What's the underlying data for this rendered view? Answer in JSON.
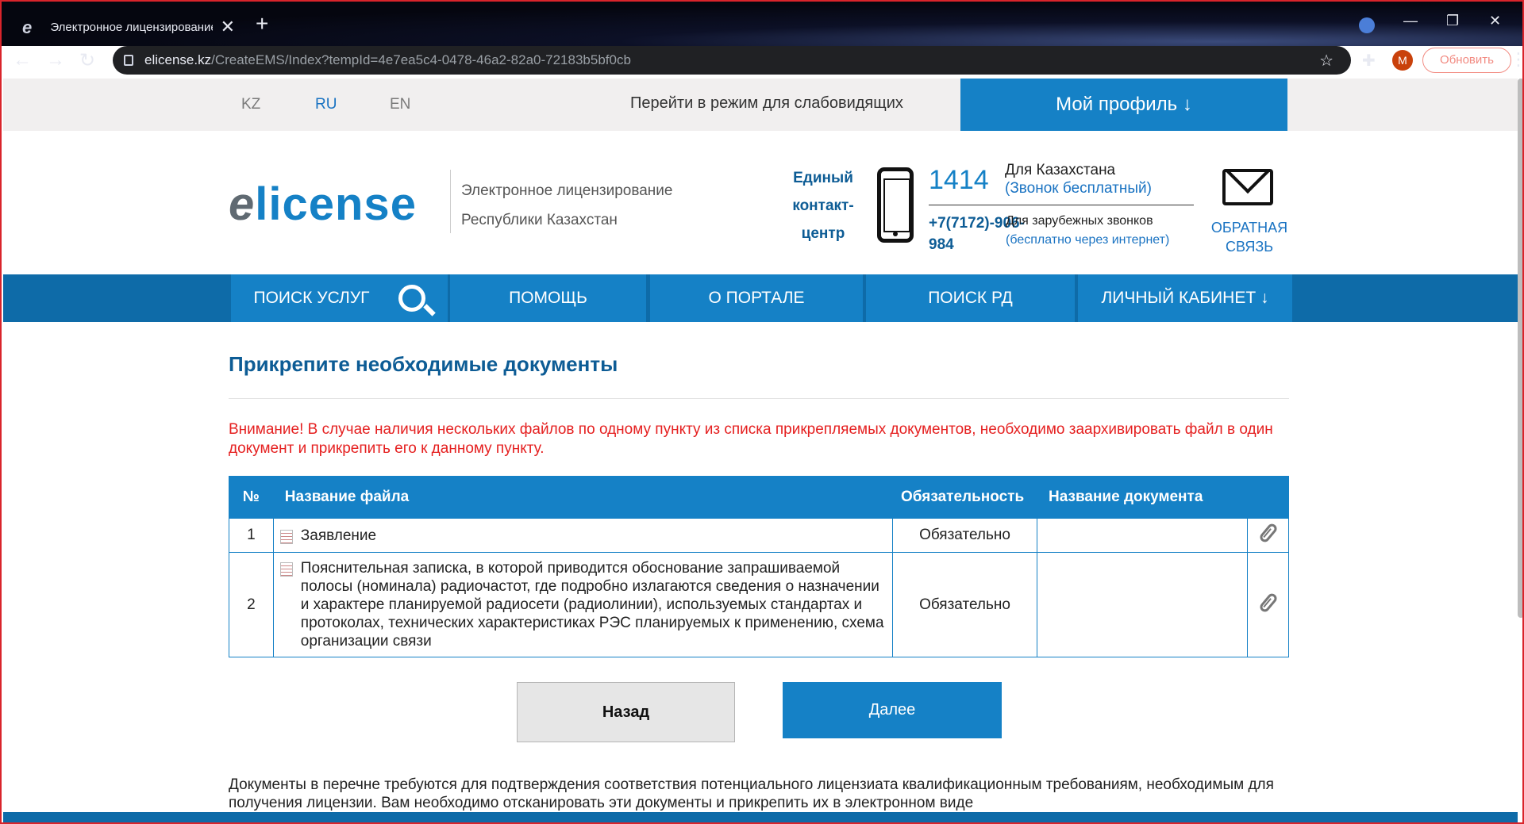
{
  "browser": {
    "tab_title": "Электронное лицензирование",
    "url_host": "elicense.kz",
    "url_path": "/CreateEMS/Index?tempId=4e7ea5c4-0478-46a2-82a0-72183b5bf0cb",
    "avatar_letter": "M",
    "update_label": "Обновить"
  },
  "topbar": {
    "languages": [
      "KZ",
      "RU",
      "EN"
    ],
    "active_language": "RU",
    "accessibility_link": "Перейти в режим для слабовидящих",
    "profile_button": "Мой профиль ↓"
  },
  "header": {
    "logo_e": "e",
    "logo_text": "license",
    "subtitle_line1": "Электронное лицензирование",
    "subtitle_line2": "Республики Казахстан",
    "contact_center": "Единый контакт-центр",
    "short_number": "1414",
    "kz_label": "Для Казахстана",
    "kz_free": "(Звонок бесплатный)",
    "intl_number": "+7(7172)-906-984",
    "intl_label": "Для зарубежных звонков",
    "intl_free": "(бесплатно через интернет)",
    "feedback": "ОБРАТНАЯ СВЯЗЬ"
  },
  "nav": {
    "search": "ПОИСК УСЛУГ",
    "help": "ПОМОЩЬ",
    "about": "О ПОРТАЛЕ",
    "search_rd": "ПОИСК РД",
    "cabinet": "ЛИЧНЫЙ КАБИНЕТ ↓"
  },
  "main": {
    "title": "Прикрепите необходимые документы",
    "warning": "Внимание! В случае наличия нескольких файлов по одному пункту из списка прикрепляемых документов, необходимо заархивировать файл в один документ и прикрепить его к данному пункту.",
    "table": {
      "headers": [
        "№",
        "Название файла",
        "Обязательность",
        "Название документа"
      ],
      "rows": [
        {
          "num": "1",
          "name": "Заявление",
          "required": "Обязательно",
          "doc_name": ""
        },
        {
          "num": "2",
          "name": "Пояснительная записка, в которой приводится обоснование запрашиваемой полосы (номинала) радиочастот, где подробно излагаются сведения о назначении и характере планируемой радиосети (радиолинии), используемых стандартах и протоколах, технических характеристиках РЭС планируемых к применению, схема организации связи",
          "required": "Обязательно",
          "doc_name": ""
        }
      ]
    },
    "back_button": "Назад",
    "next_button": "Далее",
    "footnote": "Документы в перечне требуются для подтверждения соответствия потенциального лицензиата квалификационным требованиям, необходимым для получения лицензии. Вам необходимо отсканировать эти документы и прикрепить их в электронном виде"
  },
  "colors": {
    "primary": "#1581c6",
    "dark_blue": "#0d5c95",
    "warning": "#e52020"
  }
}
